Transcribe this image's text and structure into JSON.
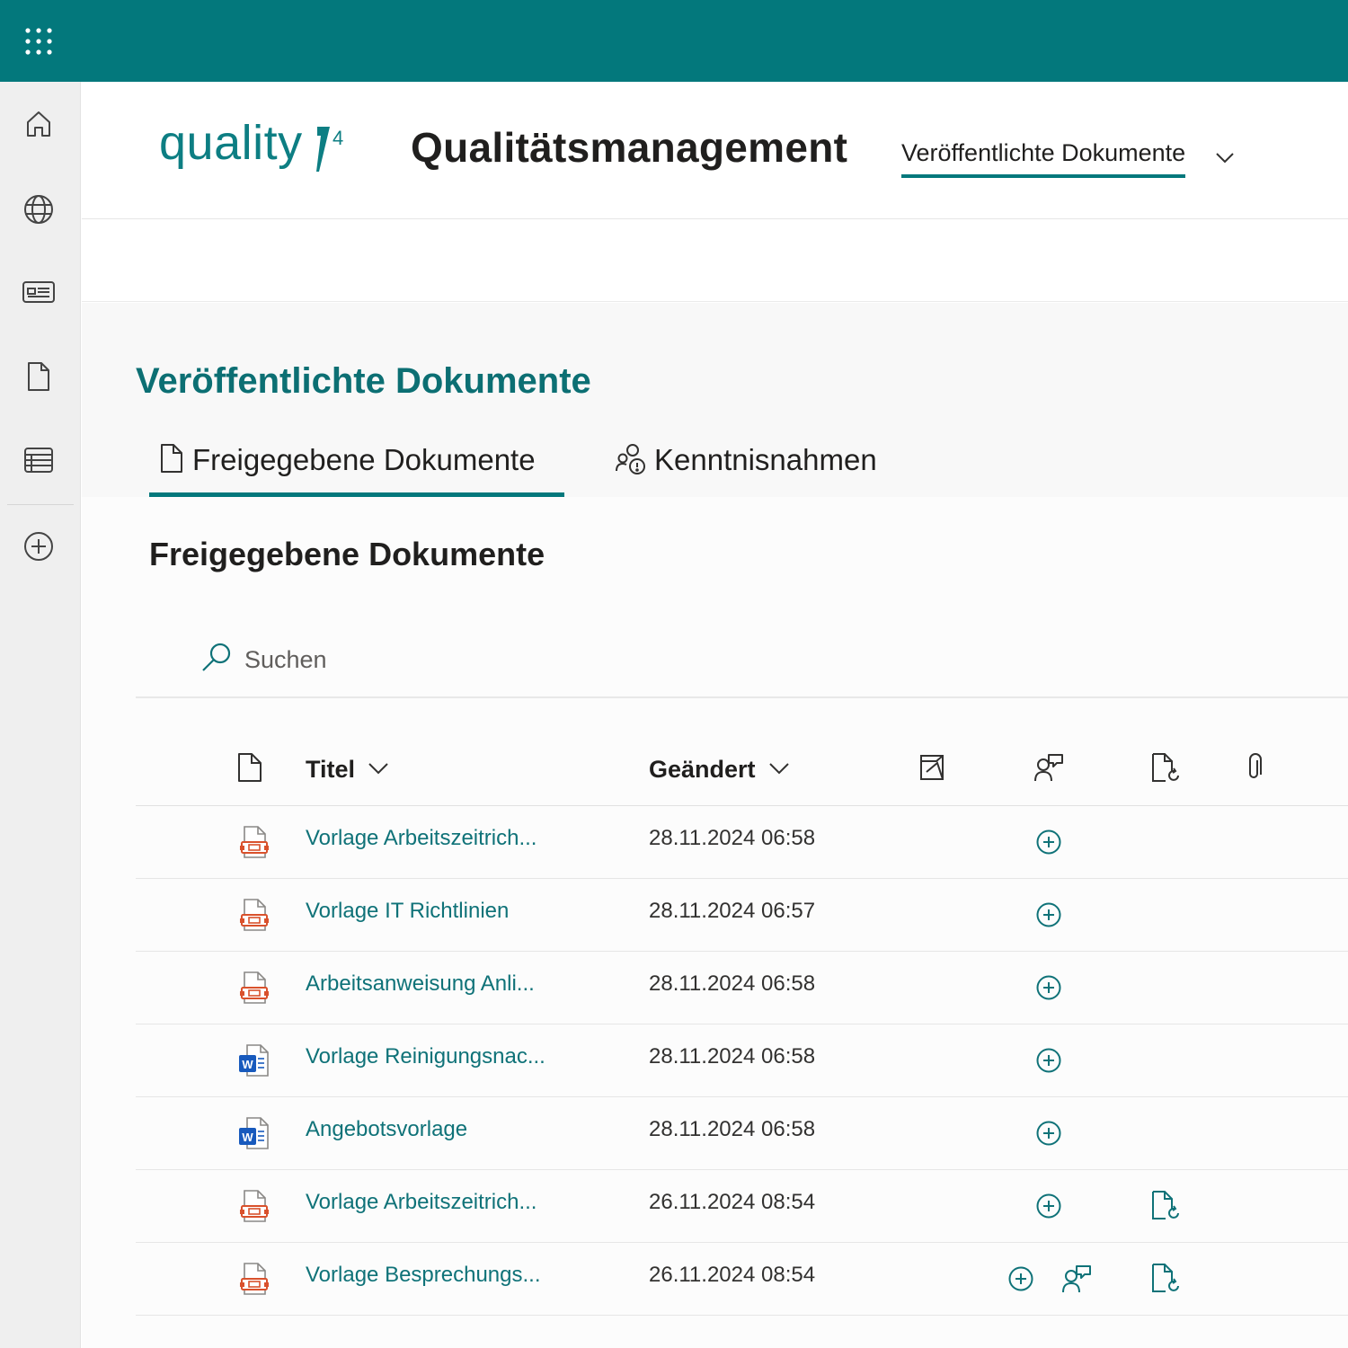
{
  "suite": {
    "app_launcher_icon": "waffle-icon"
  },
  "left_rail": {
    "items": [
      {
        "name": "home",
        "icon": "home-icon"
      },
      {
        "name": "sites",
        "icon": "globe-icon"
      },
      {
        "name": "news",
        "icon": "news-icon"
      },
      {
        "name": "files",
        "icon": "document-icon"
      },
      {
        "name": "lists",
        "icon": "list-icon"
      },
      {
        "name": "create",
        "icon": "add-circle-icon"
      }
    ]
  },
  "site": {
    "logo_text": "quality",
    "logo_sup": "4",
    "title": "Qualitätsmanagement",
    "nav_label": "Veröffentlichte Dokumente"
  },
  "page": {
    "heading": "Veröffentlichte Dokumente",
    "tabs": [
      {
        "label": "Freigegebene Dokumente",
        "icon": "document-icon",
        "active": true
      },
      {
        "label": "Kenntnisnahmen",
        "icon": "people-info-icon",
        "active": false
      }
    ],
    "section_title": "Freigegebene Dokumente",
    "search_placeholder": "Suchen"
  },
  "table": {
    "columns": {
      "type_icon": "document-icon",
      "title": "Titel",
      "modified": "Geändert",
      "col3_icon": "approval-icon",
      "col4_icon": "person-feedback-icon",
      "col5_icon": "document-refresh-icon",
      "col6_icon": "attachment-icon"
    },
    "rows": [
      {
        "file_type": "pdf",
        "title": "Vorlage Arbeitszeitrich...",
        "modified": "28.11.2024 06:58",
        "actions": [
          "add"
        ]
      },
      {
        "file_type": "pdf",
        "title": "Vorlage IT Richtlinien",
        "modified": "28.11.2024 06:57",
        "actions": [
          "add"
        ]
      },
      {
        "file_type": "pdf",
        "title": "Arbeitsanweisung Anli...",
        "modified": "28.11.2024 06:58",
        "actions": [
          "add"
        ]
      },
      {
        "file_type": "word",
        "title": "Vorlage Reinigungsnac...",
        "modified": "28.11.2024 06:58",
        "actions": [
          "add"
        ]
      },
      {
        "file_type": "word",
        "title": "Angebotsvorlage",
        "modified": "28.11.2024 06:58",
        "actions": [
          "add"
        ]
      },
      {
        "file_type": "pdf",
        "title": "Vorlage Arbeitszeitrich...",
        "modified": "26.11.2024 08:54",
        "actions": [
          "add",
          "document-refresh"
        ]
      },
      {
        "file_type": "pdf",
        "title": "Vorlage Besprechungs...",
        "modified": "26.11.2024 08:54",
        "actions": [
          "add",
          "person-feedback",
          "document-refresh"
        ]
      }
    ]
  },
  "colors": {
    "accent": "#03787c",
    "link": "#0f7278",
    "pdf": "#d9512c",
    "word": "#185abd"
  }
}
